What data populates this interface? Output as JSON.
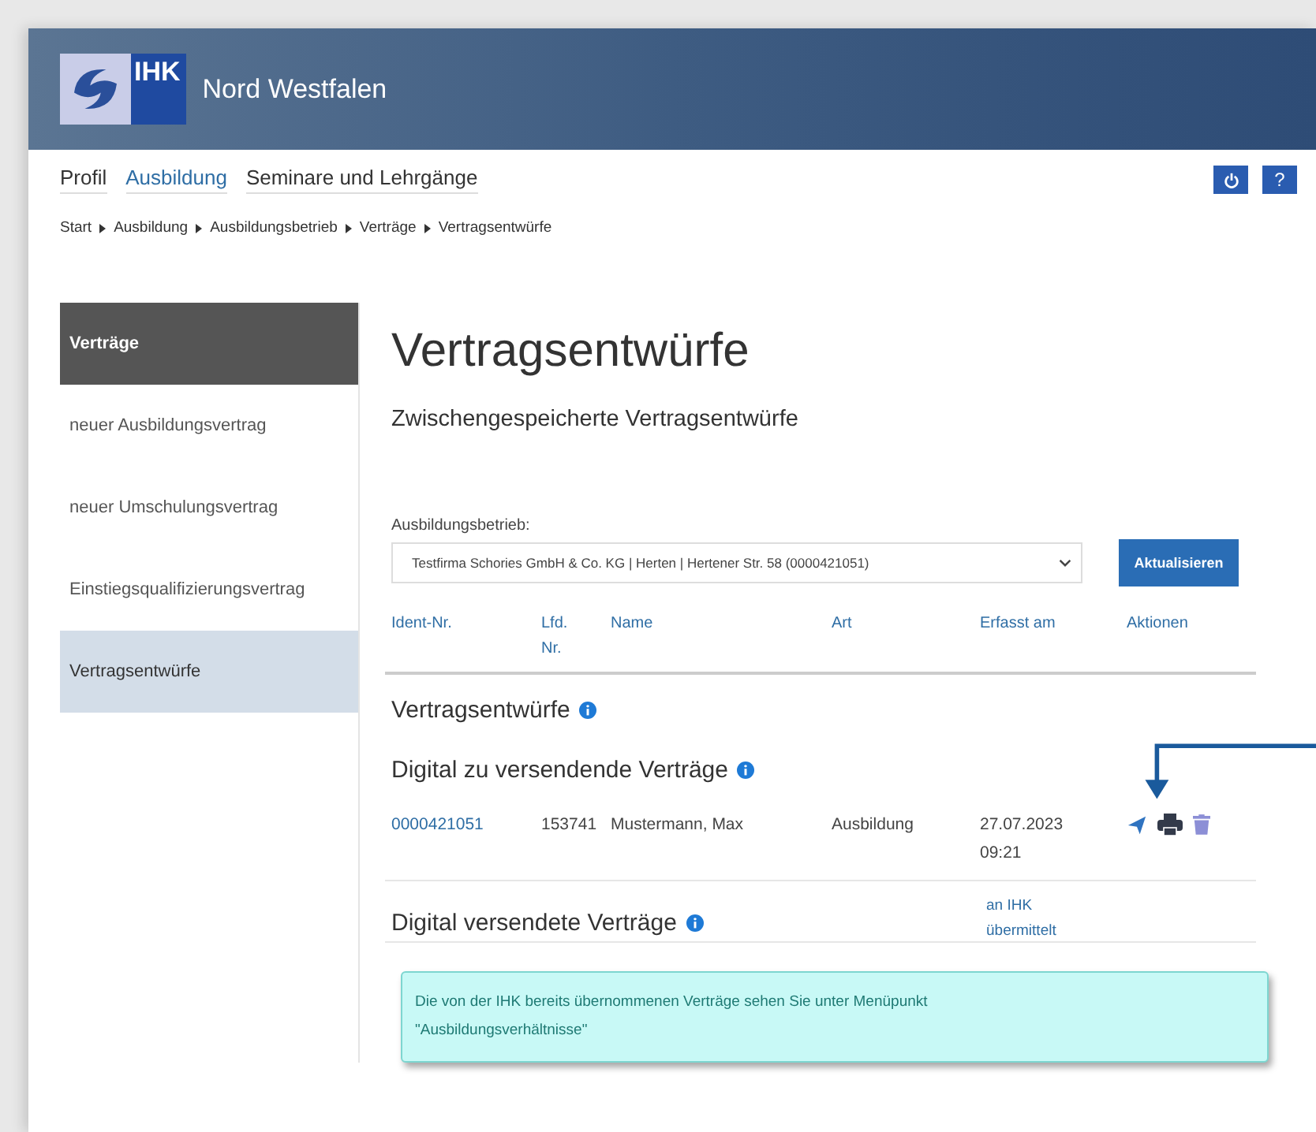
{
  "header": {
    "logo_text": "IHK",
    "title": "Nord Westfalen"
  },
  "nav": {
    "items": [
      {
        "label": "Profil",
        "selected": false
      },
      {
        "label": "Ausbildung",
        "selected": true
      },
      {
        "label": "Seminare und Lehrgänge",
        "selected": false
      }
    ],
    "buttons": [
      {
        "kind": "power"
      },
      {
        "kind": "help",
        "label": "?"
      }
    ]
  },
  "breadcrumb": [
    "Start",
    "Ausbildung",
    "Ausbildungsbetrieb",
    "Verträge",
    "Vertragsentwürfe"
  ],
  "sidebar": {
    "items": [
      {
        "label": "Verträge",
        "kind": "heading"
      },
      {
        "label": "neuer Ausbildungsvertrag",
        "kind": "link",
        "selected": false
      },
      {
        "label": "neuer Umschulungsvertrag",
        "kind": "link",
        "selected": false
      },
      {
        "label": "Einstiegsqualifizierungsvertrag",
        "kind": "link",
        "selected": false
      },
      {
        "label": "Vertragsentwürfe",
        "kind": "link",
        "selected": true
      }
    ]
  },
  "main": {
    "title": "Vertragsentwürfe",
    "subtitle": "Zwischengespeicherte Vertragsentwürfe",
    "company_label": "Ausbildungsbetrieb:",
    "company_select": {
      "value": "Testfirma Schories GmbH & Co. KG | Herten | Hertener Str. 58 (0000421051)"
    },
    "refresh_button": "Aktualisieren",
    "columns": [
      "Ident-Nr.",
      "Lfd. Nr.",
      "Name",
      "Art",
      "Erfasst am",
      "Aktionen"
    ],
    "sections": [
      {
        "title": "Vertragsentwürfe",
        "kind": "main",
        "info": true
      },
      {
        "title": "Digital zu versendende Verträge",
        "kind": "sub",
        "info": true,
        "rows": [
          {
            "ident": "0000421051",
            "lfd": "153741",
            "name": "Mustermann, Max",
            "art": "Ausbildung",
            "erfasst": "27.07.2023 09:21",
            "actions": [
              {
                "kind": "send"
              },
              {
                "kind": "print"
              },
              {
                "kind": "delete"
              }
            ]
          }
        ]
      },
      {
        "title": "Digital versendete Verträge",
        "kind": "sub",
        "info": true,
        "status": "an IHK übermittelt"
      }
    ],
    "notice": "Die von der IHK bereits übernommenen Verträge sehen Sie unter Menüpunkt \"Ausbildungsverhältnisse\""
  }
}
